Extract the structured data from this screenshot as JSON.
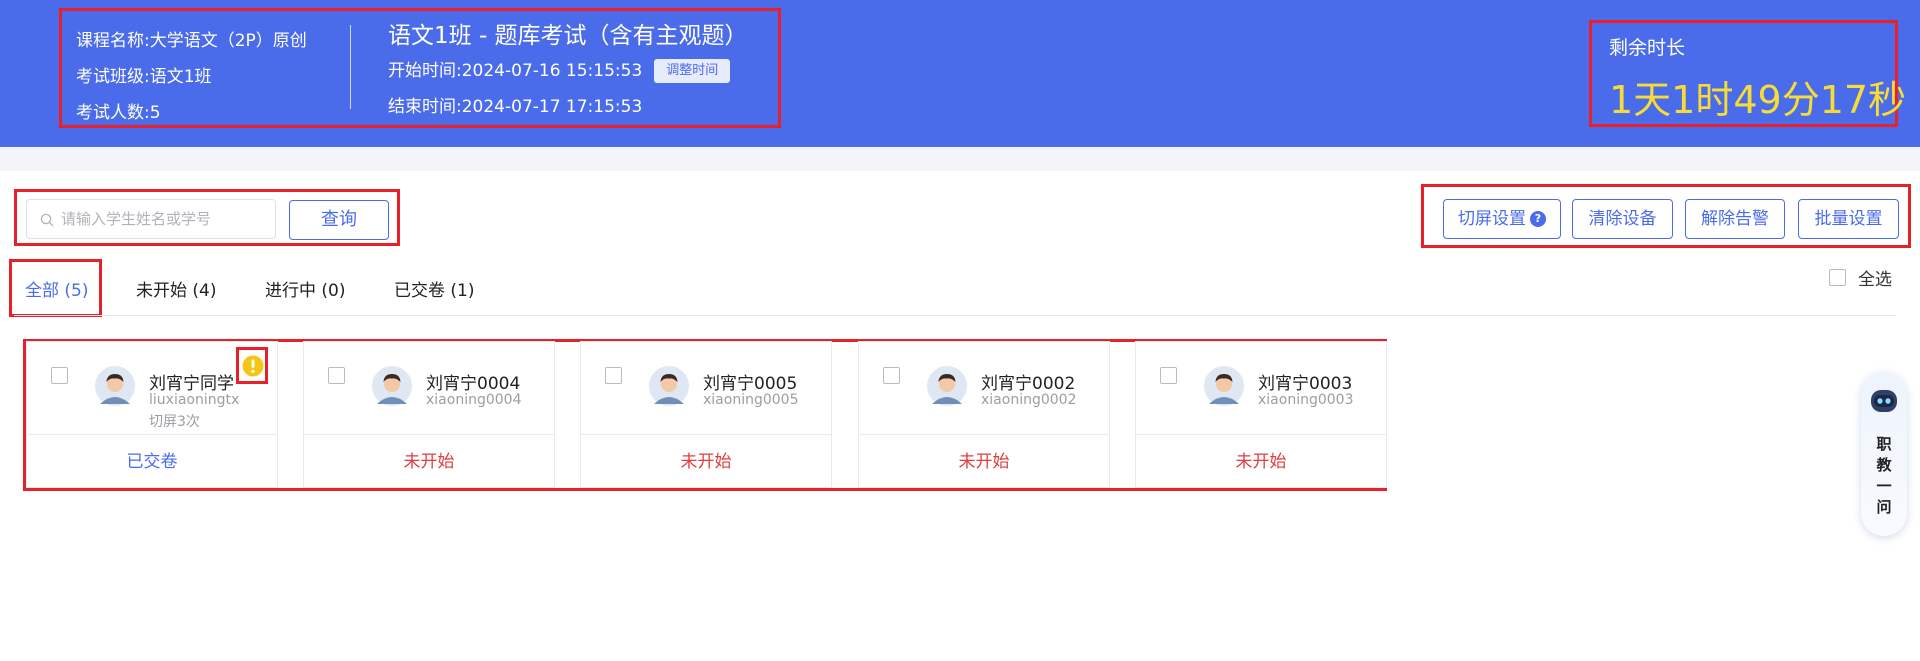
{
  "header": {
    "course_label": "课程名称:大学语文（2P）原创",
    "class_label": "考试班级:语文1班",
    "count_label": "考试人数:5",
    "exam_title": "语文1班 - 题库考试（含有主观题）",
    "start_label": "开始时间:2024-07-16 15:15:53",
    "adjust_btn": "调整时间",
    "end_label": "结束时间:2024-07-17 17:15:53",
    "remain_label": "剩余时长",
    "remain_time": "1天1时49分17秒"
  },
  "search": {
    "placeholder": "请输入学生姓名或学号",
    "query_btn": "查询"
  },
  "actions": {
    "switch_screen": "切屏设置",
    "clear_device": "清除设备",
    "release_alarm": "解除告警",
    "batch_settings": "批量设置"
  },
  "tabs": [
    {
      "label": "全部 (5)",
      "active": true
    },
    {
      "label": "未开始 (4)",
      "active": false
    },
    {
      "label": "进行中 (0)",
      "active": false
    },
    {
      "label": "已交卷 (1)",
      "active": false
    }
  ],
  "select_all": "全选",
  "students": [
    {
      "name": "刘宵宁同学",
      "id": "liuxiaoningtx",
      "extra": "切屏3次",
      "status": "已交卷",
      "status_type": "submitted",
      "warning": true
    },
    {
      "name": "刘宵宁0004",
      "id": "xiaoning0004",
      "extra": "",
      "status": "未开始",
      "status_type": "notstarted",
      "warning": false
    },
    {
      "name": "刘宵宁0005",
      "id": "xiaoning0005",
      "extra": "",
      "status": "未开始",
      "status_type": "notstarted",
      "warning": false
    },
    {
      "name": "刘宵宁0002",
      "id": "xiaoning0002",
      "extra": "",
      "status": "未开始",
      "status_type": "notstarted",
      "warning": false
    },
    {
      "name": "刘宵宁0003",
      "id": "xiaoning0003",
      "extra": "",
      "status": "未开始",
      "status_type": "notstarted",
      "warning": false
    }
  ],
  "helper": {
    "text": "职教一问"
  },
  "colors": {
    "primary": "#4b6cea",
    "countdown": "#f7dc36",
    "not_started": "#e23d3d",
    "highlight_box": "#e8202a"
  }
}
